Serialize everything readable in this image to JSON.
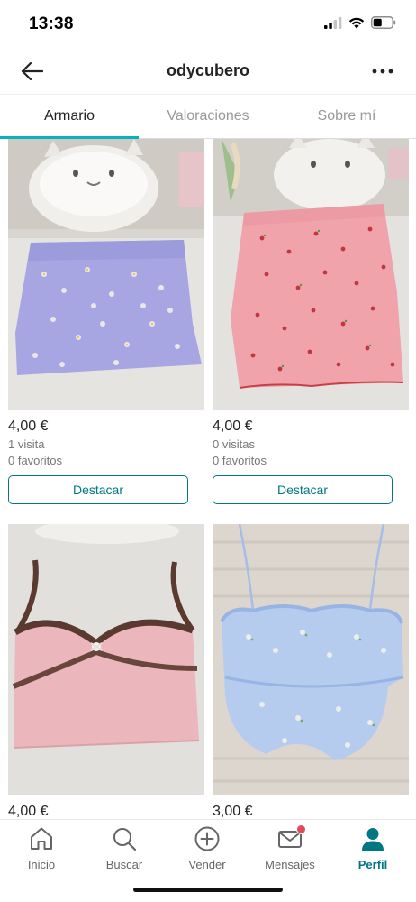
{
  "status_bar": {
    "time": "13:38"
  },
  "nav": {
    "title": "odycubero"
  },
  "tabs": [
    {
      "label": "Armario",
      "active": true
    },
    {
      "label": "Valoraciones",
      "active": false
    },
    {
      "label": "Sobre mí",
      "active": false
    }
  ],
  "items": [
    {
      "image": "lilac floral mini skirt",
      "price": "4,00 €",
      "visits": "1 visita",
      "favorites": "0 favoritos",
      "button": "Destacar"
    },
    {
      "image": "pink cherry print skirt",
      "price": "4,00 €",
      "visits": "0 visitas",
      "favorites": "0 favoritos",
      "button": "Destacar"
    },
    {
      "image": "pink crop top with brown lace trim",
      "price": "4,00 €"
    },
    {
      "image": "blue floral ruched crop top",
      "price": "3,00 €"
    }
  ],
  "bottom_nav": [
    {
      "label": "Inicio",
      "icon": "home-icon",
      "active": false
    },
    {
      "label": "Buscar",
      "icon": "search-icon",
      "active": false
    },
    {
      "label": "Vender",
      "icon": "plus-circle-icon",
      "active": false
    },
    {
      "label": "Mensajes",
      "icon": "mail-icon",
      "active": false,
      "badge": true
    },
    {
      "label": "Perfil",
      "icon": "person-icon",
      "active": true
    }
  ],
  "colors": {
    "accent": "#09b1ba",
    "brand": "#007782",
    "badge": "#e04a5a"
  }
}
